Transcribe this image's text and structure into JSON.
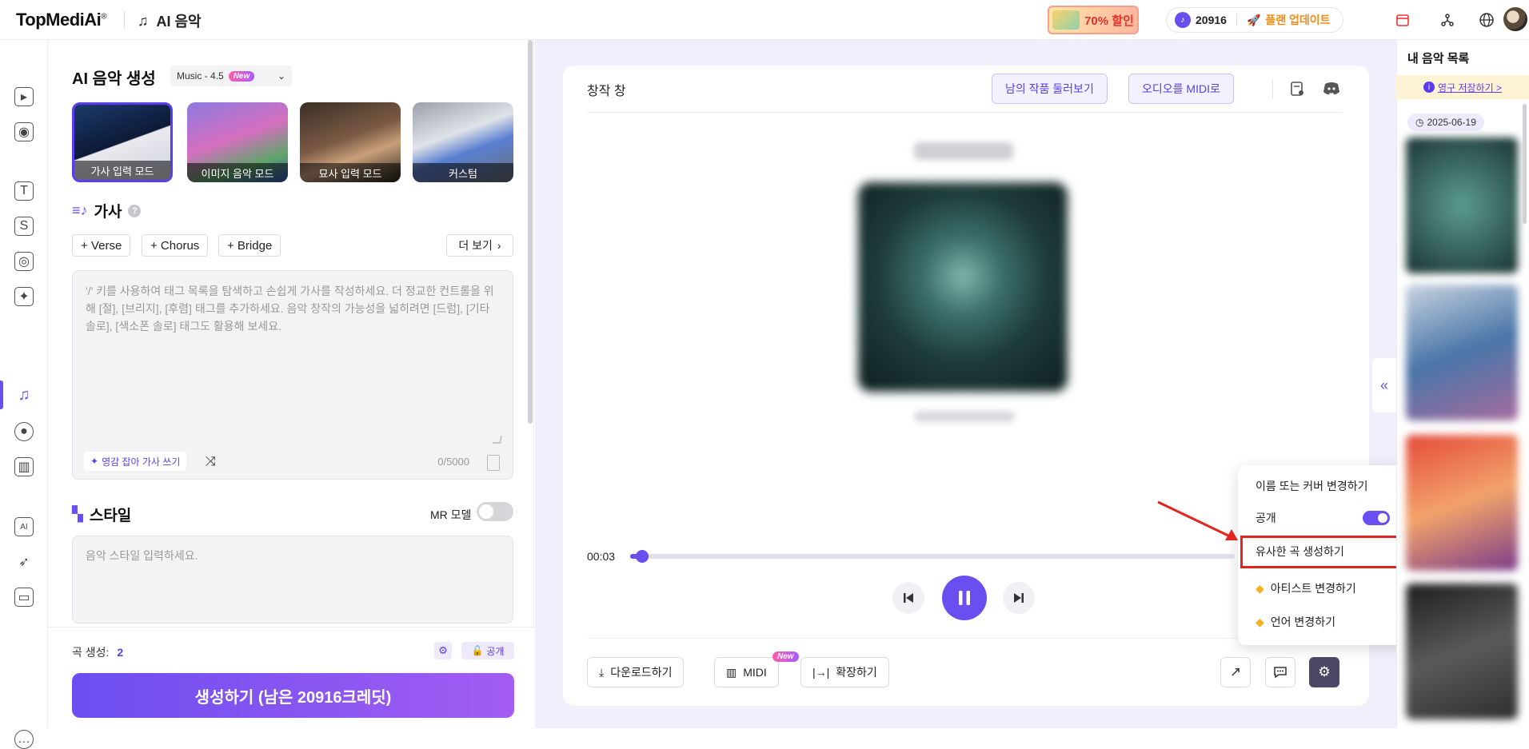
{
  "topbar": {
    "logo": "TopMediAi",
    "logo_mark": "®",
    "app_title": "AI 음악",
    "promo_label": "70% 할인",
    "credits": "20916",
    "upgrade_label": "플랜 업데이트"
  },
  "left_panel": {
    "title": "AI 음악 생성",
    "model": "Music - 4.5",
    "new_badge": "New",
    "modes": [
      {
        "label": "가사 입력 모드"
      },
      {
        "label": "이미지 음악 모드"
      },
      {
        "label": "묘사 입력 모드"
      },
      {
        "label": "커스텀"
      }
    ],
    "lyrics": {
      "title": "가사",
      "tags": [
        "+ Verse",
        "+ Chorus",
        "+ Bridge"
      ],
      "more_label": "더 보기",
      "placeholder": "'/' 키를 사용하여 태그 목록을 탐색하고 손쉽게 가사를 작성하세요. 더 정교한 컨트롤을 위해 [절], [브리지], [후렴] 태그를 추가하세요. 음악 창작의 가능성을 넓히려면 [드럼], [기타 솔로], [색소폰 솔로] 태그도 활용해 보세요.",
      "inspire_label": "영감 잡아 가사 쓰기",
      "char_count": "0/5000"
    },
    "style": {
      "title": "스타일",
      "mr_label": "MR 모델",
      "placeholder": "음악 스타일 입력하세요."
    },
    "bottom": {
      "song_count_label": "곡 생성:",
      "song_count": "2",
      "public_label": "공개",
      "generate_label": "생성하기 (남은 20916크레딧)"
    }
  },
  "center": {
    "title": "창작 창",
    "browse_label": "남의 작품 둘러보기",
    "midi_convert_label": "오디오를 MIDI로",
    "time": "00:03",
    "progress_fraction": 0.02,
    "actions": {
      "download": "다운로드하기",
      "midi": "MIDI",
      "midi_badge": "New",
      "extend": "확장하기"
    }
  },
  "menu": {
    "items": [
      {
        "label": "이름 또는 커버 변경하기"
      },
      {
        "label": "공개"
      },
      {
        "label": "유사한 곡 생성하기"
      },
      {
        "label": "아티스트 변경하기"
      },
      {
        "label": "언어 변경하기"
      }
    ]
  },
  "right_panel": {
    "title": "내 음악 목록",
    "banner": "영구 저장하기 >",
    "date": "2025-06-19"
  },
  "colors": {
    "accent": "#6b4ef0",
    "highlight": "#e3241f"
  }
}
